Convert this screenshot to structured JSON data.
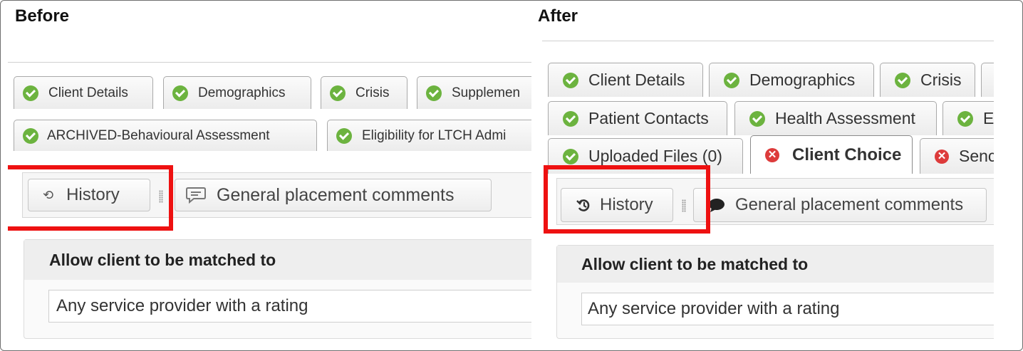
{
  "before": {
    "heading": "Before",
    "tabs_row1": [
      "Client Details",
      "Demographics",
      "Crisis",
      "Supplemen"
    ],
    "tabs_row2": [
      "ARCHIVED-Behavioural Assessment",
      "Eligibility for LTCH Admi"
    ],
    "history_label": "History",
    "comments_label": "General placement comments",
    "section_title": "Allow client to be matched to",
    "select_value": "Any service provider with a rating"
  },
  "after": {
    "heading": "After",
    "tabs_row1": [
      "Client Details",
      "Demographics",
      "Crisis"
    ],
    "tabs_row2": [
      "Patient Contacts",
      "Health Assessment",
      "E"
    ],
    "tabs_row3": [
      "Uploaded Files (0)",
      "Client Choice",
      "Senc"
    ],
    "history_label": "History",
    "comments_label": "General placement comments",
    "section_title": "Allow client to be matched to",
    "select_value": "Any service provider with a rating"
  },
  "colors": {
    "success": "#6cb33f",
    "error": "#dd3b3b",
    "highlight": "#ee1111"
  },
  "icons": [
    "check-circle-icon",
    "error-circle-icon",
    "history-icon",
    "comment-icon",
    "grip-icon"
  ]
}
